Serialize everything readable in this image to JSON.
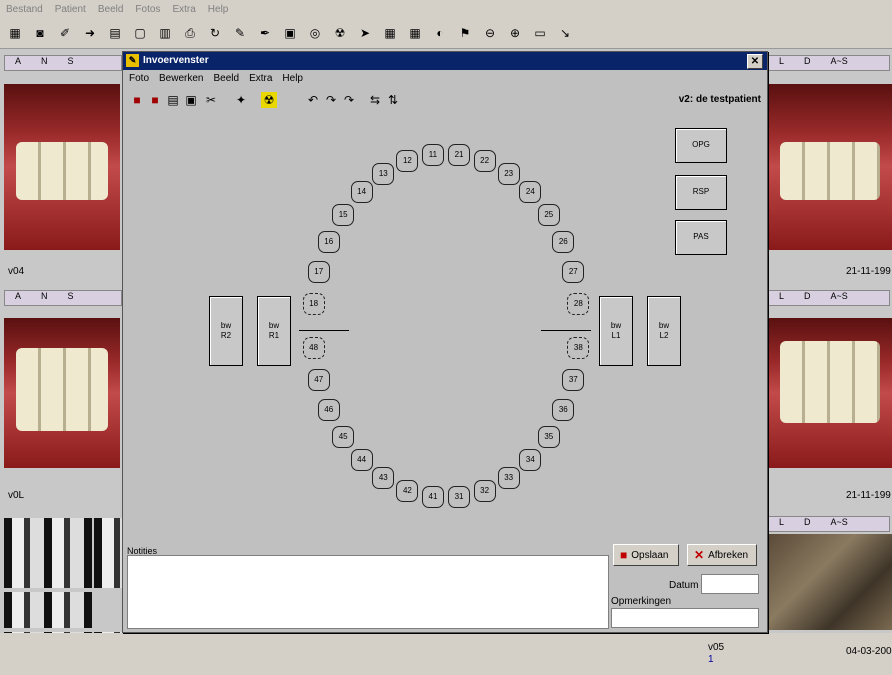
{
  "main_menu": [
    "Bestand",
    "Patient",
    "Beeld",
    "Fotos",
    "Extra",
    "Help"
  ],
  "toolbar_icons": [
    "scan-icon",
    "camera-icon",
    "paint-icon",
    "arrow-icon",
    "folder-icon",
    "document-icon",
    "grid-icon",
    "print-icon",
    "refresh-icon",
    "brush-icon",
    "pen-icon",
    "image-icon",
    "target-icon",
    "radiation-icon",
    "pointer-icon",
    "tiles-icon",
    "tiles2-icon",
    "contrast-icon",
    "flag-icon",
    "zoom-out-icon",
    "zoom-in-icon",
    "monitor-icon",
    "exit-icon"
  ],
  "left_strip_labels": [
    "A",
    "N",
    "S"
  ],
  "right_strip_labels": [
    "L",
    "D",
    "A~S"
  ],
  "left_photo_labels": [
    "v04",
    "v0L"
  ],
  "right_photo_dates": [
    "21-11-199",
    "21-11-199"
  ],
  "bottom_right": {
    "code": "v05",
    "num": "1",
    "date": "04-03-200"
  },
  "dialog": {
    "title": "Invoervenster",
    "menu": [
      "Foto",
      "Bewerken",
      "Beeld",
      "Extra",
      "Help"
    ],
    "patient_label": "v2: de testpatient",
    "tool_icons": [
      "new-icon",
      "save-icon",
      "open-icon",
      "copy-icon",
      "cut-icon",
      "settings-icon",
      "radiation-icon",
      "undo-icon",
      "redo-icon",
      "redo2-icon",
      "flip-h-icon",
      "flip-v-icon"
    ],
    "side_buttons": [
      "OPG",
      "RSP",
      "PAS"
    ],
    "bitewings": {
      "left_outer": [
        "bw",
        "R2"
      ],
      "left_inner": [
        "bw",
        "R1"
      ],
      "right_inner": [
        "bw",
        "L1"
      ],
      "right_outer": [
        "bw",
        "L2"
      ]
    },
    "teeth_upper": [
      "18",
      "17",
      "16",
      "15",
      "14",
      "13",
      "12",
      "11",
      "21",
      "22",
      "23",
      "24",
      "25",
      "26",
      "27",
      "28"
    ],
    "teeth_lower": [
      "48",
      "47",
      "46",
      "45",
      "44",
      "43",
      "42",
      "41",
      "31",
      "32",
      "33",
      "34",
      "35",
      "36",
      "37",
      "38"
    ],
    "notes_label": "Notities",
    "buttons": {
      "save": "Opslaan",
      "cancel": "Afbreken"
    },
    "date_label": "Datum",
    "remarks_label": "Opmerkingen"
  },
  "colors": {
    "titlebar": "#0a246a",
    "dialog_bg": "#c0c0c0",
    "lip": "#9b2a2a"
  }
}
